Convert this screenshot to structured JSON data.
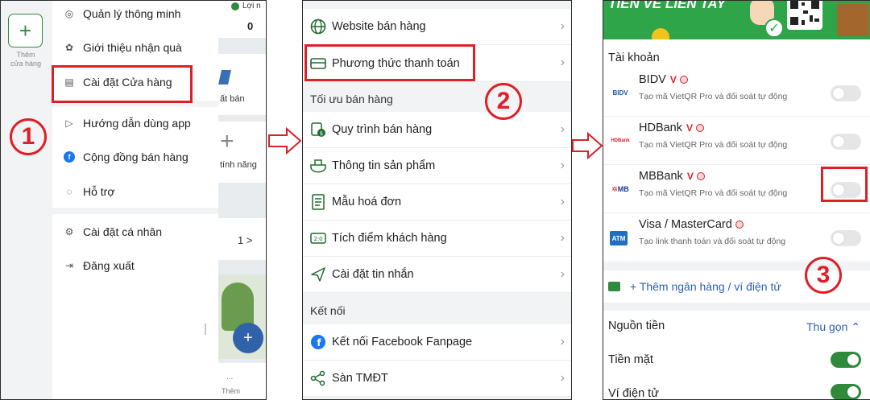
{
  "panel1": {
    "add_store_icon": "plus-icon",
    "add_store_label_line1": "Thêm",
    "add_store_label_line2": "cửa hàng",
    "menu_items": [
      {
        "label": "Quản lý thông minh",
        "icon": "smart-manage-icon"
      },
      {
        "label": "Giới thiệu nhận quà",
        "icon": "gift-icon"
      },
      {
        "label": "Cài đặt Cửa hàng",
        "icon": "store-settings-icon"
      },
      {
        "label": "Hướng dẫn dùng app",
        "icon": "play-circle-icon"
      },
      {
        "label": "Cộng đồng bán hàng",
        "icon": "facebook-icon"
      },
      {
        "label": "Hỗ trợ",
        "icon": "chat-icon"
      },
      {
        "label": "Cài đặt cá nhân",
        "icon": "gear-icon"
      },
      {
        "label": "Đăng xuất",
        "icon": "logout-icon"
      }
    ],
    "bg_top_label": "Lợi n",
    "bg_top_value": "0",
    "bg_ban_label": "ất bán",
    "bg_feature_label": "tính năng",
    "bg_count": "1 >",
    "bg_more_label": "Thêm",
    "bg_more_dots": "...",
    "step_number": "1"
  },
  "panel2": {
    "rows_top": [
      {
        "label": "Website bán hàng",
        "icon": "globe-icon"
      },
      {
        "label": "Phương thức thanh toán",
        "icon": "card-icon"
      }
    ],
    "section_optimize": "Tối ưu bán hàng",
    "rows_optimize": [
      {
        "label": "Quy trình bán hàng",
        "icon": "process-icon"
      },
      {
        "label": "Thông tin sản phẩm",
        "icon": "product-icon"
      },
      {
        "label": "Mẫu hoá đơn",
        "icon": "invoice-icon"
      },
      {
        "label": "Tích điểm khách hàng",
        "icon": "points-icon"
      },
      {
        "label": "Cài đặt tin nhắn",
        "icon": "send-icon"
      }
    ],
    "section_connect": "Kết nối",
    "rows_connect": [
      {
        "label": "Kết nối Facebook Fanpage",
        "icon": "facebook-icon"
      },
      {
        "label": "Sàn TMĐT",
        "icon": "share-icon"
      }
    ],
    "step_number": "2"
  },
  "panel3": {
    "banner_text": "TIỀN VỀ LIỀN TAY",
    "accounts_title": "Tài khoản",
    "banks": [
      {
        "name": "BIDV",
        "logo": "BIDV",
        "desc": "Tạo mã VietQR Pro và đối soát tự động",
        "enabled": false
      },
      {
        "name": "HDBank",
        "logo": "HDBank",
        "desc": "Tạo mã VietQR Pro và đối soát tự động",
        "enabled": false
      },
      {
        "name": "MBBank",
        "logo": "MB",
        "desc": "Tạo mã VietQR Pro và đối soát tự động",
        "enabled": false
      },
      {
        "name": "Visa / MasterCard",
        "logo": "ATM",
        "desc": "Tạo link thanh toán và đối soát tự động",
        "enabled": false
      }
    ],
    "v_tag": "V",
    "add_bank_label": "+ Thêm ngân hàng / ví điện tử",
    "funds_title": "Nguồn tiền",
    "collapse_label": "Thu gọn",
    "funds": [
      {
        "label": "Tiền mặt",
        "enabled": true
      },
      {
        "label": "Ví điện tử",
        "enabled": true
      }
    ],
    "step_number": "3"
  },
  "colors": {
    "accent_red": "#e01e25",
    "brand_green": "#2f8a3c",
    "banner_green": "#2fa54a"
  }
}
